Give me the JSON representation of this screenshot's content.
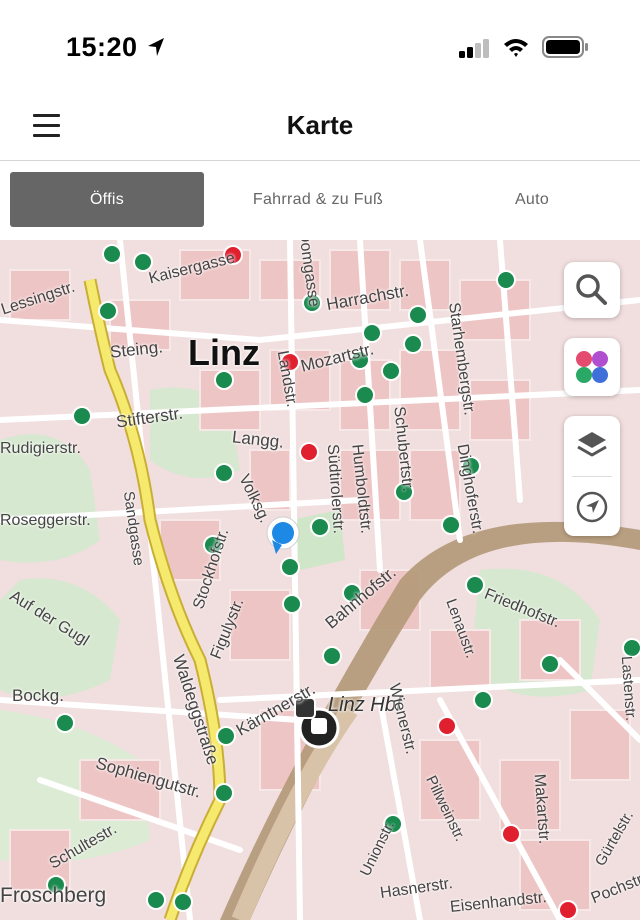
{
  "status": {
    "time": "15:20"
  },
  "nav": {
    "title": "Karte"
  },
  "tabs": [
    {
      "label": "Öffis",
      "active": true
    },
    {
      "label": "Fahrrad & zu Fuß",
      "active": false
    },
    {
      "label": "Auto",
      "active": false
    }
  ],
  "map": {
    "city": "Linz",
    "station": "Linz Hbf",
    "streets": [
      "Steing.",
      "Stifterstr.",
      "Langg.",
      "Volksg.",
      "Stockhofstr.",
      "Figulystr.",
      "Waldeggstraße",
      "Sandgasse",
      "Bockg.",
      "Sophiengutstr.",
      "Schultestr.",
      "Froschberg",
      "Hasnerstr.",
      "Unionstr.",
      "Pillweinstr.",
      "Wienerstr.",
      "Makartstr.",
      "Gürtelstr.",
      "Lenaustr.",
      "Dinghoferstr.",
      "Starhembergstr.",
      "Schubertstr.",
      "Humboldtstr.",
      "Südtirolerstr.",
      "Bahnhofstr.",
      "Friedhofstr.",
      "Kärntnerstr.",
      "Harrachstr.",
      "Mozartstr.",
      "Landstr.",
      "Auf der Gugl",
      "Lessingstr.",
      "Rudigierstr.",
      "Lastenstr.",
      "Domgasse",
      "Kaisergasse",
      "Roseggerstr.",
      "Eisenhandstr.",
      "Pochstr."
    ]
  },
  "controls": {
    "search_icon": "search-icon",
    "apps_icon": "colorful-dots-icon",
    "layers_icon": "layers-icon",
    "locate_icon": "navigation-arrow-icon"
  },
  "colors": {
    "tab_active": "#666666",
    "stop_green": "#1b8a4e",
    "stop_red": "#e0202f",
    "location_blue": "#1e88e5",
    "main_road": "#f6ea6e"
  }
}
